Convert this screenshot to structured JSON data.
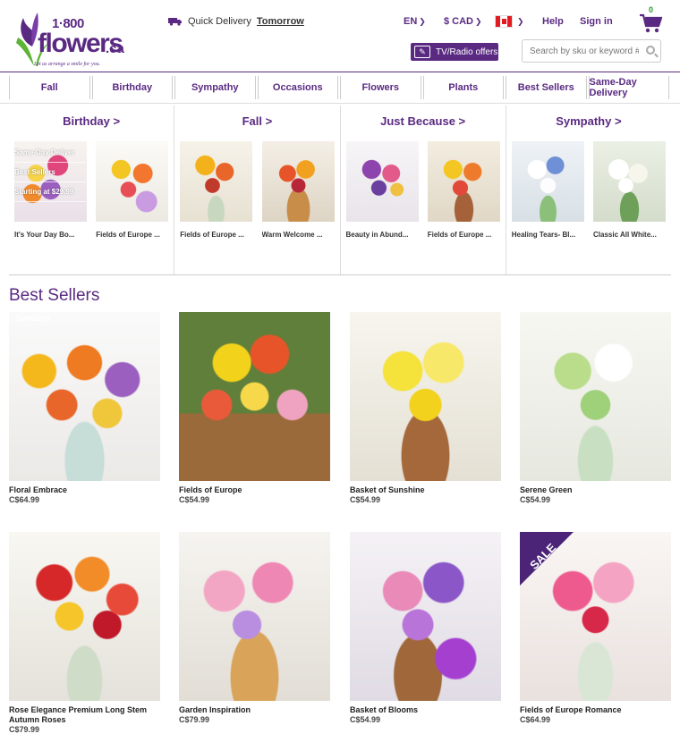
{
  "brand": {
    "number": "1·800",
    "name": "flowers",
    "tld": ".ca",
    "tagline": "Let us arrange a smile for you."
  },
  "header": {
    "delivery_label": "Quick Delivery",
    "delivery_when": "Tomorrow",
    "language": "EN",
    "currency": "$ CAD",
    "help": "Help",
    "sign_in": "Sign in",
    "cart_count": "0",
    "tv_offers": "TV/Radio offers",
    "search_placeholder": "Search by sku or keyword #"
  },
  "nav": [
    "Fall",
    "Birthday",
    "Sympathy",
    "Occasions",
    "Flowers",
    "Plants",
    "Best Sellers",
    "Same-Day Delivery"
  ],
  "categories": [
    {
      "title": "Birthday >",
      "items": [
        "It's Your Day Bo...",
        "Fields of Europe ..."
      ]
    },
    {
      "title": "Fall >",
      "items": [
        "Fields of Europe ...",
        "Warm Welcome ..."
      ]
    },
    {
      "title": "Just Because >",
      "items": [
        "Beauty in Abund...",
        "Fields of Europe ..."
      ]
    },
    {
      "title": "Sympathy >",
      "items": [
        "Healing Tears- Bl...",
        "Classic All White..."
      ]
    }
  ],
  "overlay_menu": [
    "Same-Day Deliver",
    "Best Sellers",
    "Starting at $29.99"
  ],
  "best_sellers": {
    "title": "Best Sellers",
    "sympathy_label": "Sympathy",
    "products": [
      {
        "name": "Floral Embrace",
        "price": "C$64.99"
      },
      {
        "name": "Fields of Europe",
        "price": "C$54.99"
      },
      {
        "name": "Basket of Sunshine",
        "price": "C$54.99"
      },
      {
        "name": "Serene Green",
        "price": "C$54.99"
      },
      {
        "name": "Rose Elegance Premium Long Stem Autumn Roses",
        "price": "C$79.99"
      },
      {
        "name": "Garden Inspiration",
        "price": "C$79.99"
      },
      {
        "name": "Basket of Blooms",
        "price": "C$54.99"
      },
      {
        "name": "Fields of Europe Romance",
        "price": "C$64.99",
        "badge": "SALE"
      }
    ]
  },
  "colors": {
    "brand_purple": "#5a2a82",
    "leaf_green": "#5cb335",
    "flag_red": "#e21b23"
  }
}
